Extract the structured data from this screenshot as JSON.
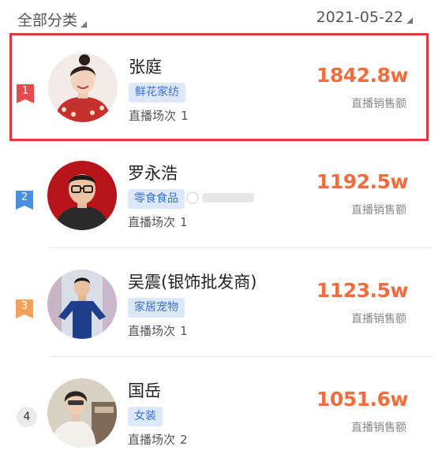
{
  "filters": {
    "category": "全部分类",
    "date": "2021-05-22"
  },
  "ranking": [
    {
      "rank": "1",
      "name": "张庭",
      "tag": "鲜花家纺",
      "sessions_label": "直播场次",
      "sessions": "1",
      "value": "1842.8w",
      "value_label": "直播销售额"
    },
    {
      "rank": "2",
      "name": "罗永浩",
      "tag": "零食食品",
      "sessions_label": "直播场次",
      "sessions": "1",
      "value": "1192.5w",
      "value_label": "直播销售额"
    },
    {
      "rank": "3",
      "name": "吴震(银饰批发商)",
      "tag": "家居宠物",
      "sessions_label": "直播场次",
      "sessions": "1",
      "value": "1123.5w",
      "value_label": "直播销售额"
    },
    {
      "rank": "4",
      "name": "国岳",
      "tag": "女装",
      "sessions_label": "直播场次",
      "sessions": "2",
      "value": "1051.6w",
      "value_label": "直播销售额"
    }
  ],
  "colors": {
    "highlight_border": "#e0393e",
    "value": "#f26d3d",
    "tag_bg": "#dde9fb",
    "tag_text": "#3a6fd8",
    "rank1": "#e8494a",
    "rank2": "#4a90e2",
    "rank3": "#f2a25a",
    "rank4_bg": "#ebebeb"
  },
  "icons": {
    "dropdown": "triangle-down-right-icon",
    "rank_badge": "bookmark-badge-icon"
  }
}
